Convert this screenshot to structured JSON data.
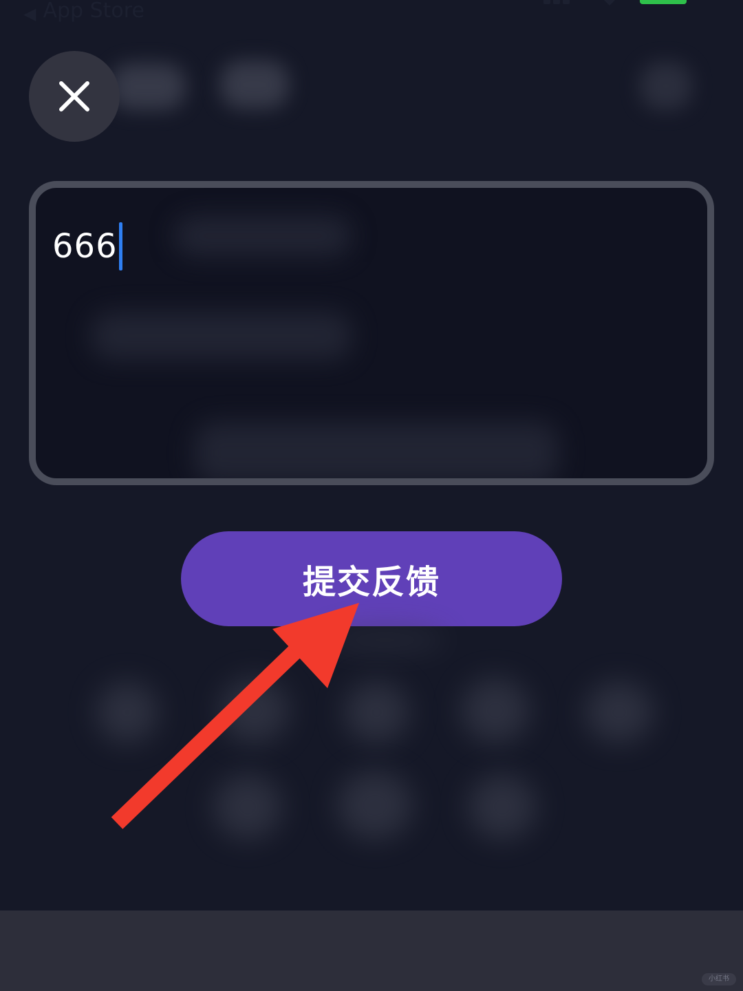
{
  "status_bar": {
    "back_arrow": "◀",
    "back_label": "App Store",
    "icons": [
      "signal-icon",
      "wifi-icon",
      "battery-icon"
    ],
    "battery_color": "#2fc04b"
  },
  "header": {
    "close_icon": "close-icon"
  },
  "feedback": {
    "value": "666",
    "cursor_color": "#2f7ff2",
    "border_color": "#4a4d5a"
  },
  "submit": {
    "label": "提交反馈",
    "color": "#6040b8"
  },
  "annotation": {
    "arrow_color": "#f23a2c"
  },
  "watermark": {
    "text": "小红书"
  },
  "theme": {
    "background": "#151827",
    "bottom_bar": "#2d2e3a"
  }
}
